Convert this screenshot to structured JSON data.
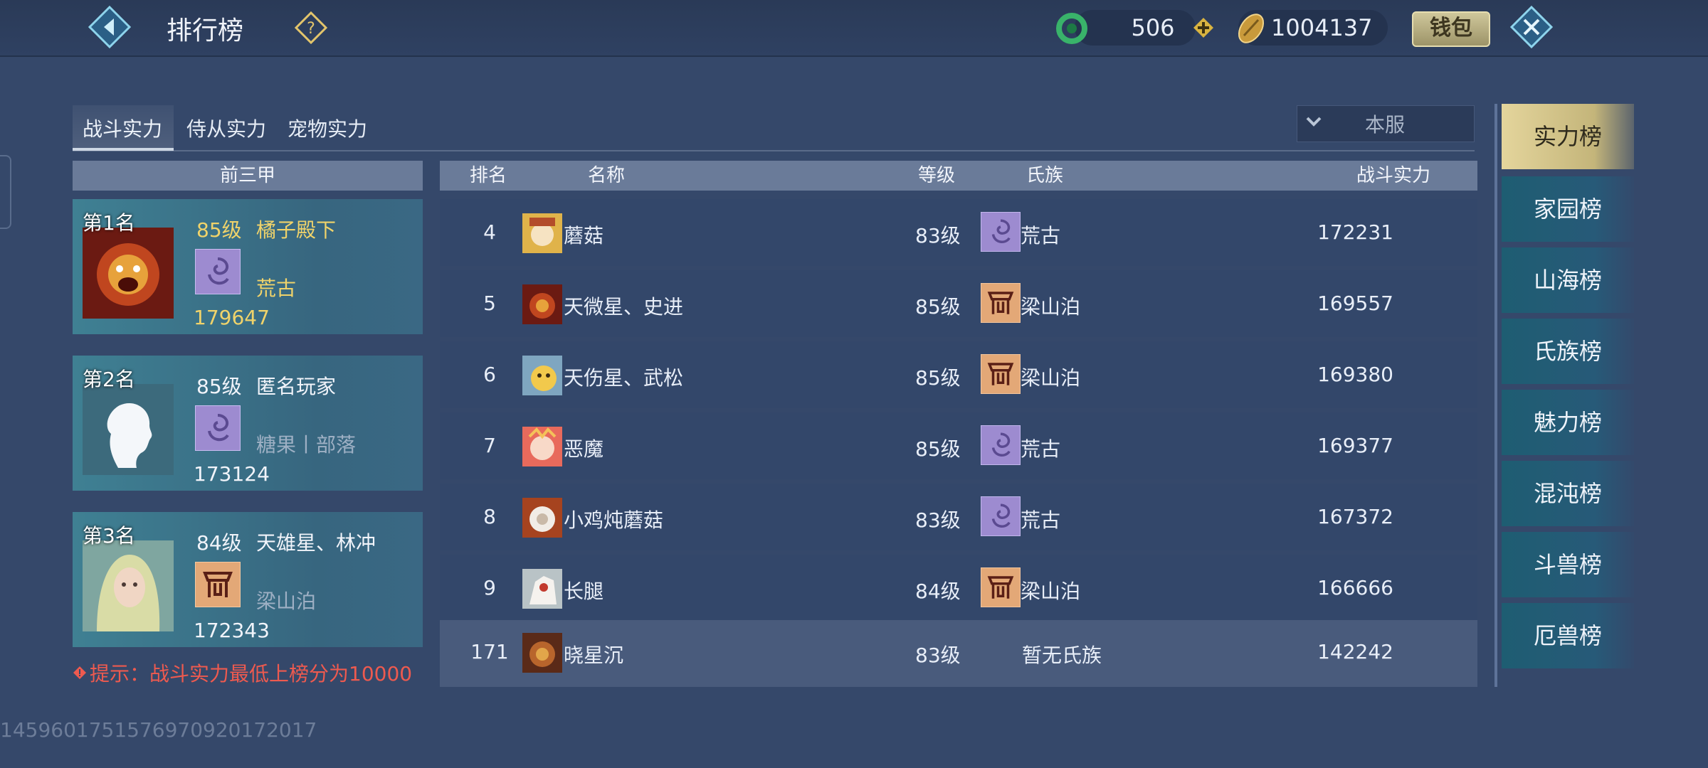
{
  "header": {
    "title": "排行榜",
    "jade_value": "506",
    "coin_value": "1004137",
    "wallet_label": "钱包"
  },
  "tabs": [
    {
      "label": "战斗实力",
      "active": true
    },
    {
      "label": "侍从实力",
      "active": false
    },
    {
      "label": "宠物实力",
      "active": false
    }
  ],
  "server_select": {
    "value": "本服"
  },
  "top3": {
    "header": "前三甲",
    "entries": [
      {
        "rank_label": "第1名",
        "level": "85级",
        "name": "橘子殿下",
        "clan": "荒古",
        "power": "179647"
      },
      {
        "rank_label": "第2名",
        "level": "85级",
        "name": "匿名玩家",
        "clan": "糖果丨部落",
        "power": "173124"
      },
      {
        "rank_label": "第3名",
        "level": "84级",
        "name": "天雄星、林冲",
        "clan": "梁山泊",
        "power": "172343"
      }
    ],
    "tip": "提示：战斗实力最低上榜分为10000"
  },
  "table": {
    "headers": {
      "rank": "排名",
      "name": "名称",
      "level": "等级",
      "clan": "氏族",
      "power": "战斗实力"
    },
    "rows": [
      {
        "rank": "4",
        "name": "蘑菇",
        "level": "83级",
        "clan": "荒古",
        "power": "172231"
      },
      {
        "rank": "5",
        "name": "天微星、史进",
        "level": "85级",
        "clan": "梁山泊",
        "power": "169557"
      },
      {
        "rank": "6",
        "name": "天伤星、武松",
        "level": "85级",
        "clan": "梁山泊",
        "power": "169380"
      },
      {
        "rank": "7",
        "name": "恶魔",
        "level": "85级",
        "clan": "荒古",
        "power": "169377"
      },
      {
        "rank": "8",
        "name": "小鸡炖蘑菇",
        "level": "83级",
        "clan": "荒古",
        "power": "167372"
      },
      {
        "rank": "9",
        "name": "长腿",
        "level": "84级",
        "clan": "梁山泊",
        "power": "166666"
      }
    ],
    "my_row": {
      "rank": "171",
      "name": "晓星沉",
      "level": "83级",
      "clan": "暂无氏族",
      "power": "142242"
    }
  },
  "categories": [
    {
      "label": "实力榜",
      "active": true
    },
    {
      "label": "家园榜"
    },
    {
      "label": "山海榜"
    },
    {
      "label": "氏族榜"
    },
    {
      "label": "魅力榜"
    },
    {
      "label": "混沌榜"
    },
    {
      "label": "斗兽榜"
    },
    {
      "label": "厄兽榜"
    }
  ],
  "footer_id": "1459601751576970920172017",
  "colors": {
    "background": "#35486a",
    "gold_text": "#f0d36a",
    "tip_red": "#ee5a4f",
    "active_category": "#e4d59c"
  },
  "icons": {
    "clan_huanggu": "swirl-emblem-icon",
    "clan_liangshanpo": "banner-emblem-icon",
    "jade": "jade-ring-icon",
    "coin": "gold-ingot-icon"
  }
}
